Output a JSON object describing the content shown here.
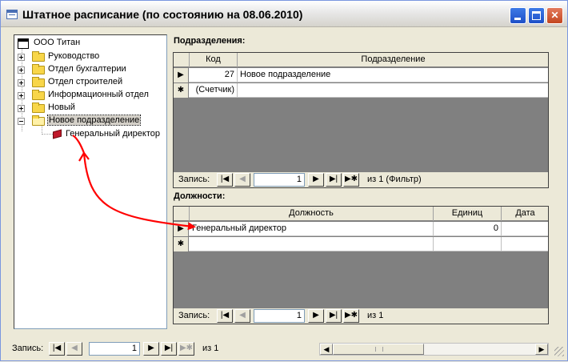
{
  "window": {
    "title": "Штатное расписание (по состоянию на 08.06.2010)"
  },
  "tree": {
    "root": "ООО Титан",
    "items": [
      {
        "label": "Руководство"
      },
      {
        "label": "Отдел бухгалтерии"
      },
      {
        "label": "Отдел строителей"
      },
      {
        "label": "Информационный отдел"
      },
      {
        "label": "Новый"
      },
      {
        "label": "Новое подразделение",
        "children": [
          {
            "label": "Генеральный директор"
          }
        ]
      }
    ]
  },
  "departments": {
    "section_label": "Подразделения:",
    "columns": [
      "Код",
      "Подразделение"
    ],
    "rows": [
      {
        "code": "27",
        "name": "Новое подразделение"
      },
      {
        "code": "(Счетчик)",
        "name": ""
      }
    ],
    "nav": {
      "label": "Запись:",
      "current": "1",
      "of_text": "из 1 (Фильтр)"
    }
  },
  "positions": {
    "section_label": "Должности:",
    "columns": [
      "Должность",
      "Единиц",
      "Дата"
    ],
    "rows": [
      {
        "title": "Генеральный директор",
        "units": "0",
        "date": ""
      }
    ],
    "nav": {
      "label": "Запись:",
      "current": "1",
      "of_text": "из 1"
    }
  },
  "main_nav": {
    "label": "Запись:",
    "current": "1",
    "of_text": "из 1"
  },
  "colors": {
    "annotation_arrow": "#ff0000",
    "folder": "#f8d649"
  }
}
